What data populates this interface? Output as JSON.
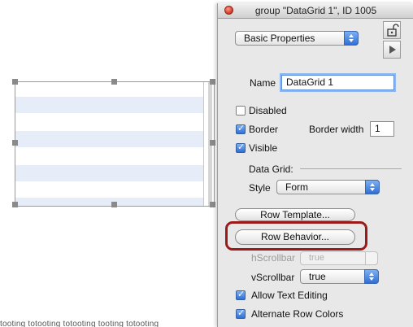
{
  "canvas": {
    "bottom_text": "tooting totooting totooting tooting totooting"
  },
  "palette": {
    "title": "group \"DataGrid 1\", ID 1005",
    "section_popup": "Basic Properties",
    "name_label": "Name",
    "name_value": "DataGrid 1",
    "disabled_label": "Disabled",
    "border_label": "Border",
    "border_width_label": "Border width",
    "border_width_value": "1",
    "visible_label": "Visible",
    "datagrid_section": "Data Grid:",
    "style_label": "Style",
    "style_value": "Form",
    "row_template_button": "Row Template...",
    "row_behavior_button": "Row Behavior...",
    "hscrollbar_label": "hScrollbar",
    "hscrollbar_value": "true",
    "vscrollbar_label": "vScrollbar",
    "vscrollbar_value": "true",
    "allow_text_editing_label": "Allow Text Editing",
    "alternate_row_colors_label": "Alternate Row Colors"
  },
  "icons": {
    "lock": "lock-icon",
    "play": "play-icon",
    "close": "close-icon"
  },
  "colors": {
    "accent": "#2f6fd6",
    "highlight_box": "#9b1b1b",
    "row_stripe": "#e6edf8"
  }
}
